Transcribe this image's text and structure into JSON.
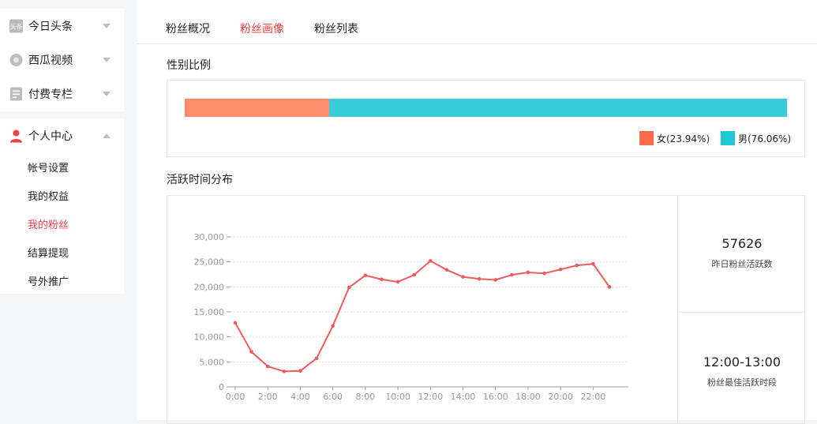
{
  "sidebar": {
    "top_items": [
      {
        "label": "今日头条",
        "icon": "toutiao-logo-icon"
      },
      {
        "label": "西瓜视频",
        "icon": "xigua-video-icon"
      },
      {
        "label": "付费专栏",
        "icon": "document-icon"
      }
    ],
    "personal_center": {
      "label": "个人中心",
      "icon": "user-icon"
    },
    "sub_items": [
      "帐号设置",
      "我的权益",
      "我的粉丝",
      "结算提现",
      "号外推广"
    ],
    "active_sub": "我的粉丝"
  },
  "tabs": [
    "粉丝概况",
    "粉丝画像",
    "粉丝列表"
  ],
  "active_tab": "粉丝画像",
  "gender": {
    "title": "性别比例",
    "female_label": "女(23.94%)",
    "male_label": "男(76.06%)",
    "female_pct": 23.94,
    "male_pct": 76.06,
    "female_color": "#ff8b6a",
    "male_color": "#36cfd9",
    "female_legend_color": "#ff6a4b",
    "male_legend_color": "#1ec8d6"
  },
  "activity": {
    "title": "活跃时间分布",
    "stat1_value": "57626",
    "stat1_label": "昨日粉丝活跃数",
    "stat2_value": "12:00-13:00",
    "stat2_label": "粉丝最佳活跃时段"
  },
  "chart_data": {
    "type": "line",
    "x": [
      "0:00",
      "1:00",
      "2:00",
      "3:00",
      "4:00",
      "5:00",
      "6:00",
      "7:00",
      "8:00",
      "9:00",
      "10:00",
      "11:00",
      "12:00",
      "13:00",
      "14:00",
      "15:00",
      "16:00",
      "17:00",
      "18:00",
      "19:00",
      "20:00",
      "21:00",
      "22:00",
      "23:00"
    ],
    "tick_labels": [
      "0:00",
      "2:00",
      "4:00",
      "6:00",
      "8:00",
      "10:00",
      "12:00",
      "14:00",
      "16:00",
      "18:00",
      "20:00",
      "22:00"
    ],
    "y_ticks": [
      "0",
      "5,000",
      "10,000",
      "15,000",
      "20,000",
      "25,000",
      "30,000"
    ],
    "values": [
      12800,
      7000,
      4100,
      3100,
      3200,
      5700,
      12200,
      19900,
      22300,
      21500,
      21000,
      22400,
      25200,
      23400,
      22000,
      21600,
      21400,
      22400,
      22900,
      22700,
      23500,
      24300,
      24600,
      20000
    ],
    "ylim": [
      0,
      30000
    ],
    "color": "#ee5b5b",
    "grid": true
  }
}
